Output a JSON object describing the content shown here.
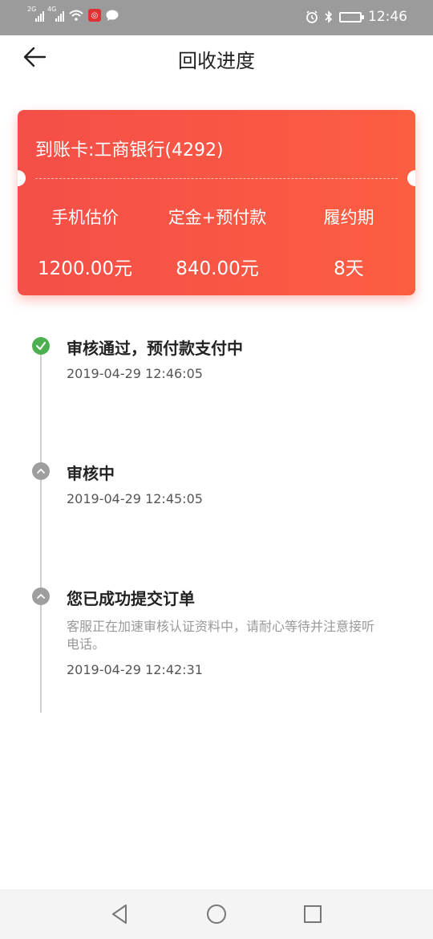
{
  "status_bar": {
    "network_1": "2G",
    "network_2": "4G",
    "time": "12:46",
    "icons": [
      "signal-icon",
      "signal-icon",
      "wifi-icon",
      "app-notification-icon",
      "message-icon",
      "alarm-icon",
      "bluetooth-icon",
      "battery-icon"
    ]
  },
  "header": {
    "title": "回收进度",
    "back_icon": "arrow-left-icon"
  },
  "card": {
    "account_line": "到账卡:工商银行(4292)",
    "columns": [
      {
        "label": "手机估价",
        "value": "1200.00元"
      },
      {
        "label": "定金+预付款",
        "value": "840.00元"
      },
      {
        "label": "履约期",
        "value": "8天"
      }
    ],
    "colors": {
      "start": "#f44f48",
      "end": "#fc5e42"
    }
  },
  "timeline": {
    "steps": [
      {
        "status": "审核通过，预付款支付中",
        "time": "2019-04-29 12:46:05",
        "icon": "check-circle-icon",
        "state": "done"
      },
      {
        "status": "审核中",
        "time": "2019-04-29 12:45:05",
        "icon": "chevron-up-circle-icon",
        "state": "pending"
      },
      {
        "status": "您已成功提交订单",
        "description": "客服正在加速审核认证资料中，请耐心等待并注意接听电话。",
        "time": "2019-04-29 12:42:31",
        "icon": "chevron-up-circle-icon",
        "state": "pending"
      }
    ],
    "colors": {
      "done": "#4caf50",
      "pending": "#9e9e9e"
    }
  },
  "nav_bar": {
    "buttons": [
      "back-triangle-icon",
      "home-circle-icon",
      "recents-square-icon"
    ]
  }
}
